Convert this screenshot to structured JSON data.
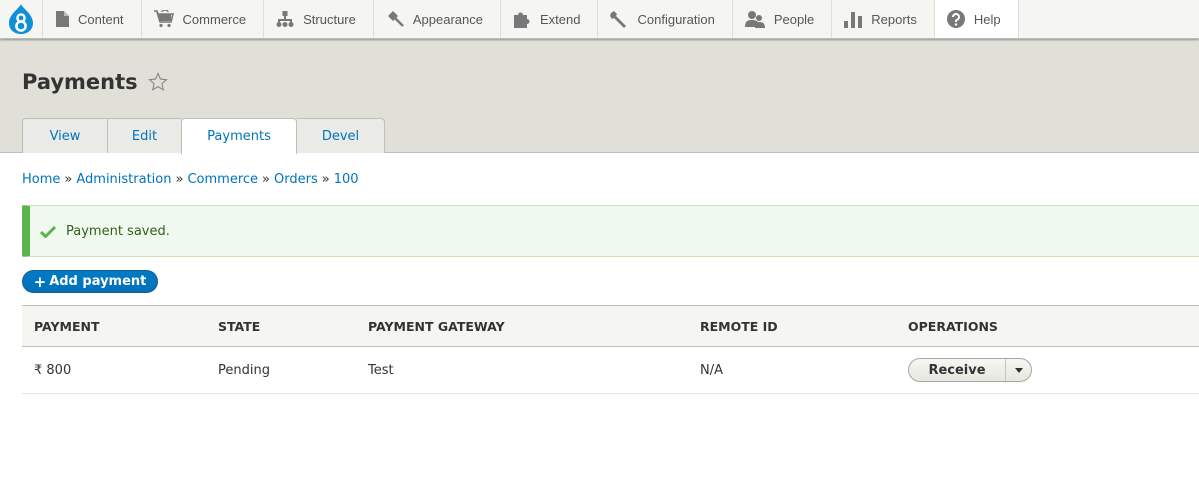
{
  "toolbar": {
    "logo": "drupal-logo",
    "items": [
      {
        "label": "Content",
        "icon": "document-icon"
      },
      {
        "label": "Commerce",
        "icon": "cart-icon"
      },
      {
        "label": "Structure",
        "icon": "sitemap-icon"
      },
      {
        "label": "Appearance",
        "icon": "paintbrush-icon"
      },
      {
        "label": "Extend",
        "icon": "puzzle-icon"
      },
      {
        "label": "Configuration",
        "icon": "wrench-icon"
      },
      {
        "label": "People",
        "icon": "people-icon"
      },
      {
        "label": "Reports",
        "icon": "bar-chart-icon"
      },
      {
        "label": "Help",
        "icon": "help-icon"
      }
    ]
  },
  "page": {
    "title": "Payments",
    "tabs": [
      {
        "label": "View",
        "active": false
      },
      {
        "label": "Edit",
        "active": false
      },
      {
        "label": "Payments",
        "active": true
      },
      {
        "label": "Devel",
        "active": false
      }
    ]
  },
  "breadcrumb": {
    "items": [
      "Home",
      "Administration",
      "Commerce",
      "Orders",
      "100"
    ],
    "separator": "»"
  },
  "message": {
    "text": "Payment saved.",
    "type": "status"
  },
  "actions": {
    "add_payment_plus": "+",
    "add_payment": "Add payment"
  },
  "table": {
    "headers": [
      "Payment",
      "State",
      "Payment gateway",
      "Remote ID",
      "Operations"
    ],
    "rows": [
      {
        "payment": "₹ 800",
        "state": "Pending",
        "gateway": "Test",
        "remote_id": "N/A",
        "operation": "Receive"
      }
    ]
  },
  "colors": {
    "link": "#0074bd",
    "primary_button": "#0071b8",
    "status_border": "#5ab34d",
    "status_bg": "#f0f9ef",
    "drupal_blue": "#0f8fd8"
  }
}
